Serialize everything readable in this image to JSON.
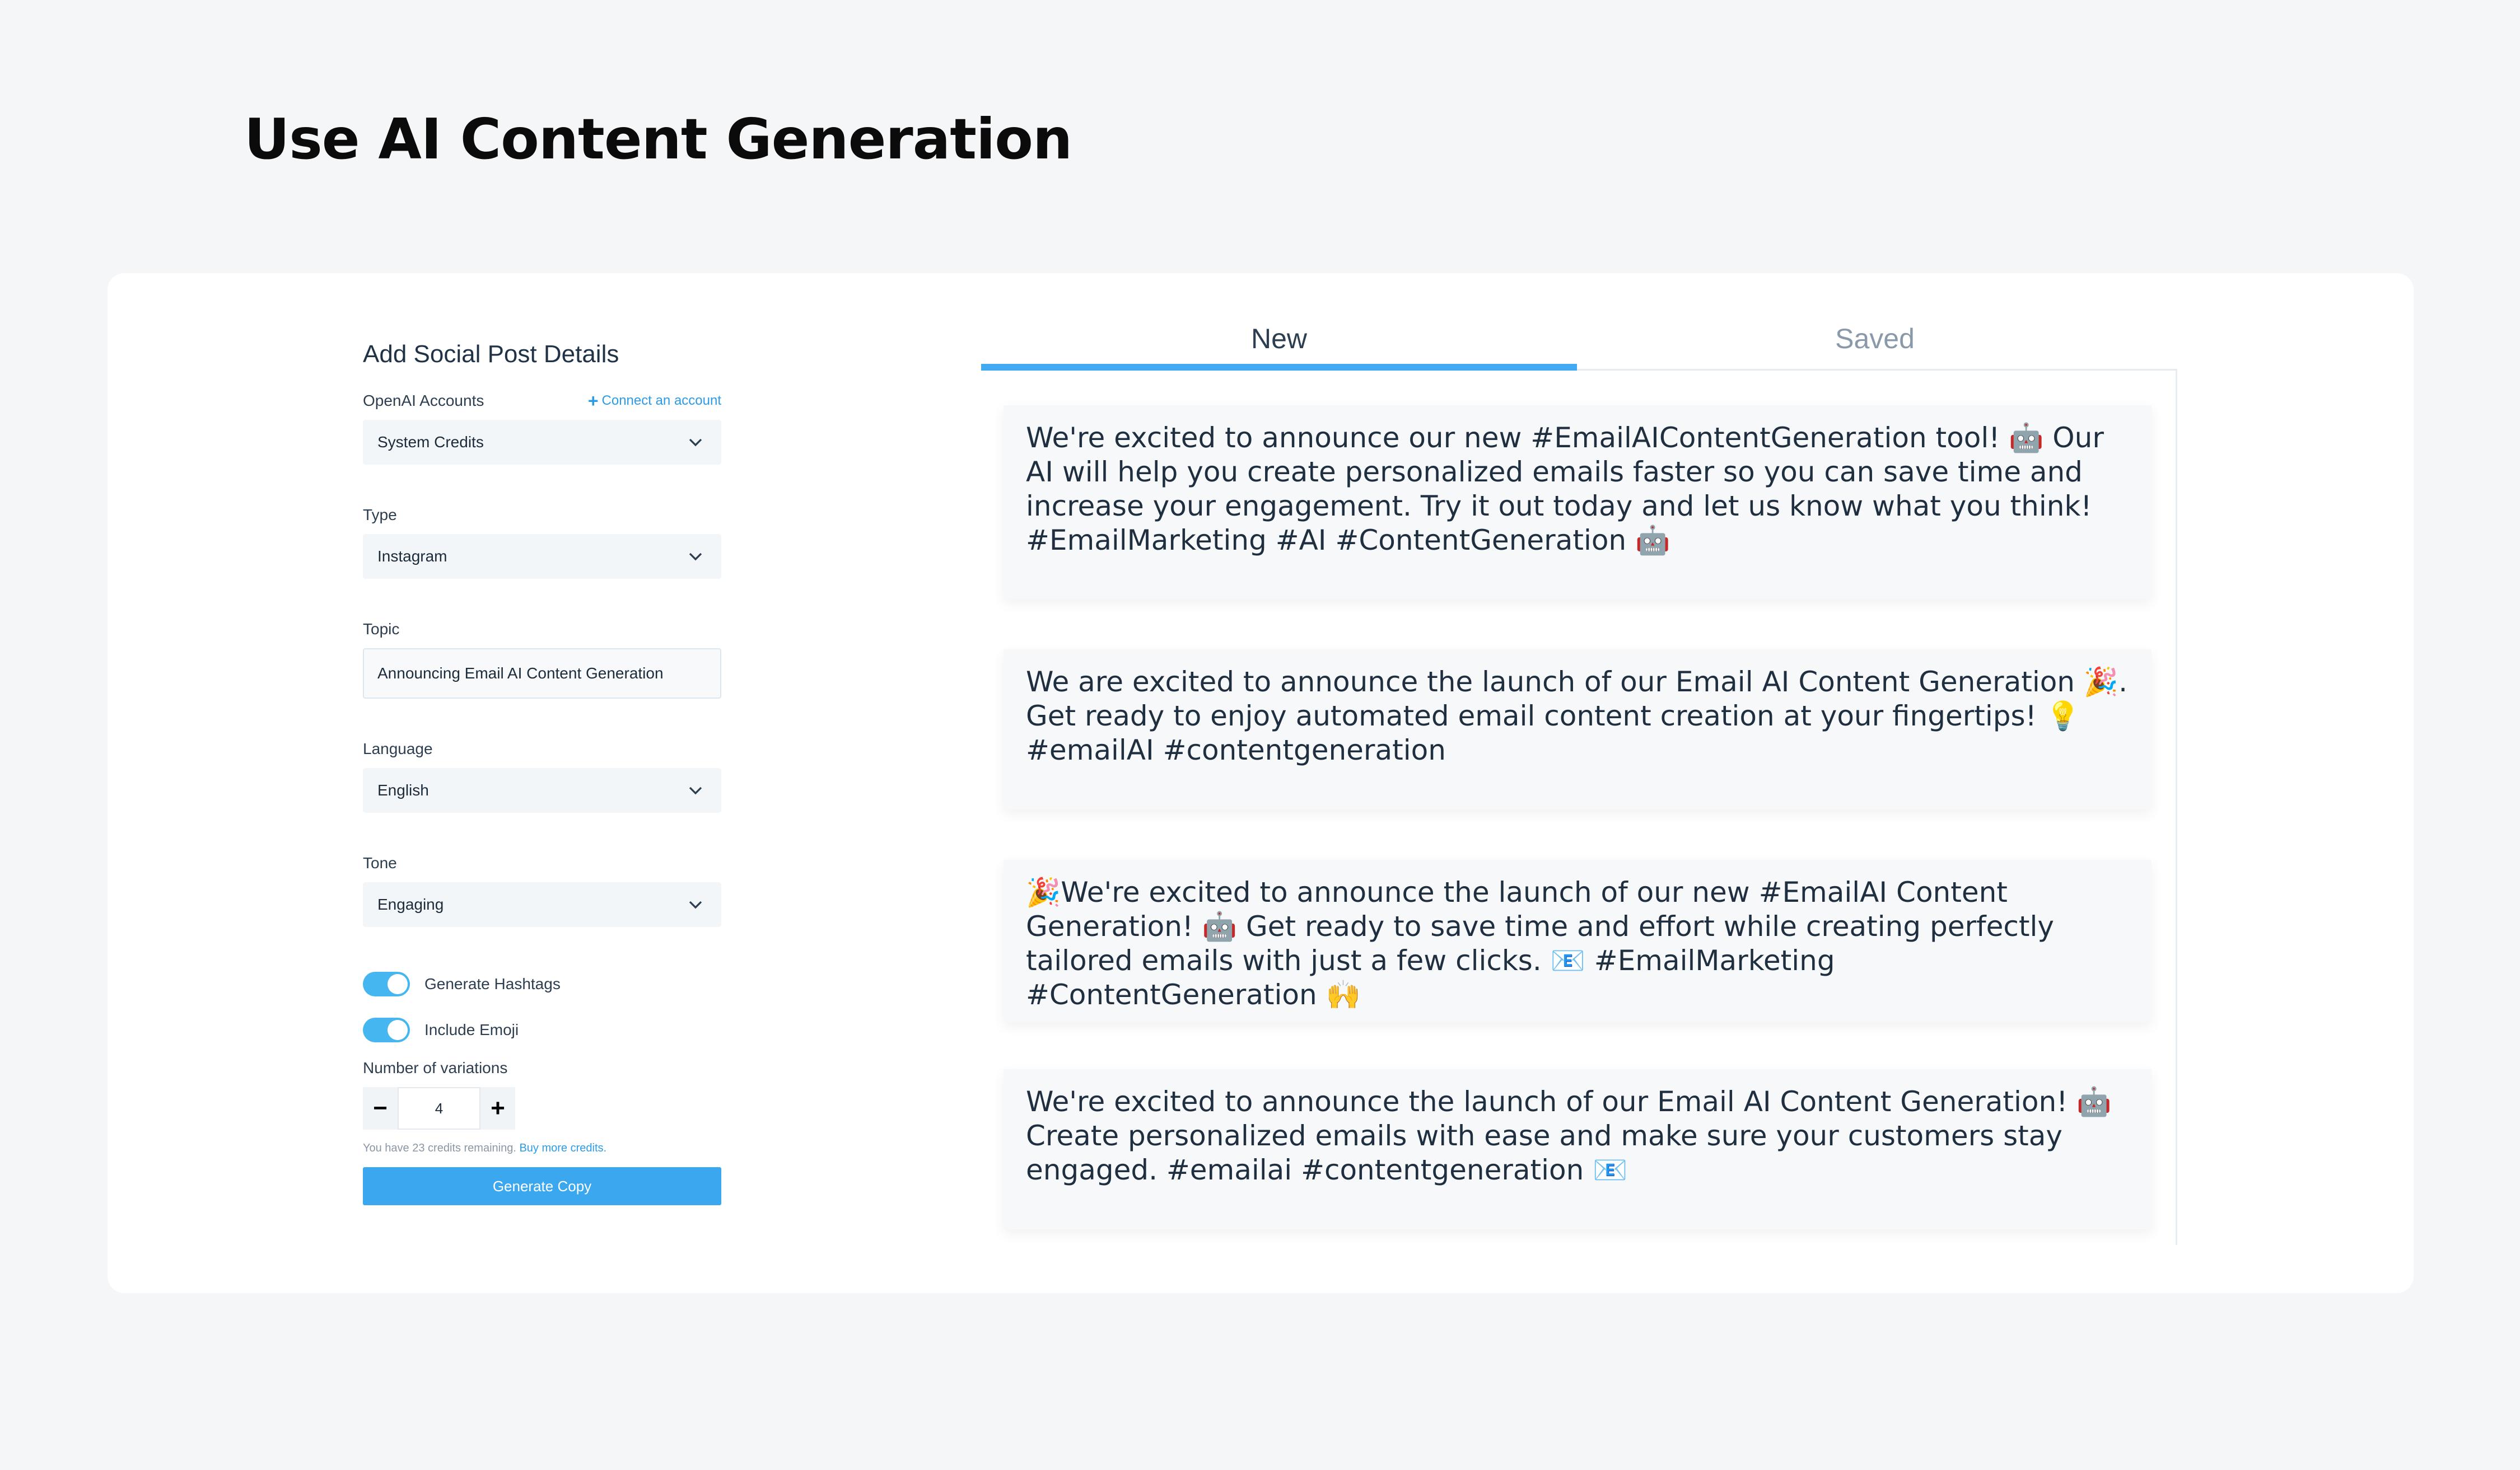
{
  "page": {
    "heading": "Use AI Content Generation"
  },
  "form": {
    "title": "Add Social Post Details",
    "openai": {
      "label": "OpenAI Accounts",
      "connect_link": "Connect an account",
      "value": "System Credits"
    },
    "type": {
      "label": "Type",
      "value": "Instagram"
    },
    "topic": {
      "label": "Topic",
      "value": "Announcing Email AI Content Generation"
    },
    "language": {
      "label": "Language",
      "value": "English"
    },
    "tone": {
      "label": "Tone",
      "value": "Engaging"
    },
    "toggles": {
      "hashtags": "Generate Hashtags",
      "emoji": "Include Emoji"
    },
    "variations": {
      "label": "Number of variations",
      "minus": "−",
      "plus": "+",
      "value": "4"
    },
    "credits_text": "You have 23 credits remaining.",
    "buy_link": "Buy more credits.",
    "generate_label": "Generate Copy"
  },
  "tabs": {
    "new": "New",
    "saved": "Saved"
  },
  "results": [
    "We're excited to announce our new #EmailAIContentGeneration tool! 🤖 Our AI will help you create personalized emails faster so you can save time and increase your engagement. Try it out today and let us know what you think! #EmailMarketing #AI #ContentGeneration 🤖",
    "We are excited to announce the launch of our Email AI Content Generation 🎉. Get ready to enjoy automated email content creation at your fingertips! 💡 #emailAI #contentgeneration",
    "🎉We're excited to announce the launch of our new #EmailAI Content Generation! 🤖 Get ready to save time and effort while creating perfectly tailored emails with just a few clicks. 📧 #EmailMarketing #ContentGeneration 🙌",
    "We're excited to announce the launch of our Email AI Content Generation! 🤖 Create personalized emails with ease and make sure your customers stay engaged. #emailai #contentgeneration 📧"
  ]
}
